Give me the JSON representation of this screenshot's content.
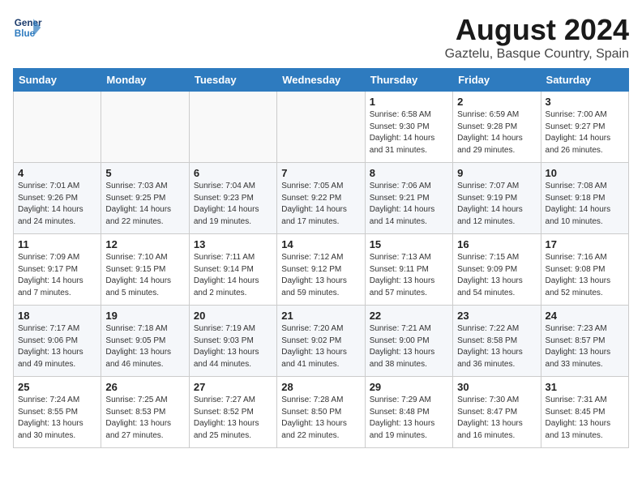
{
  "logo": {
    "line1": "General",
    "line2": "Blue"
  },
  "title": "August 2024",
  "subtitle": "Gaztelu, Basque Country, Spain",
  "days_of_week": [
    "Sunday",
    "Monday",
    "Tuesday",
    "Wednesday",
    "Thursday",
    "Friday",
    "Saturday"
  ],
  "weeks": [
    [
      {
        "num": "",
        "info": ""
      },
      {
        "num": "",
        "info": ""
      },
      {
        "num": "",
        "info": ""
      },
      {
        "num": "",
        "info": ""
      },
      {
        "num": "1",
        "info": "Sunrise: 6:58 AM\nSunset: 9:30 PM\nDaylight: 14 hours\nand 31 minutes."
      },
      {
        "num": "2",
        "info": "Sunrise: 6:59 AM\nSunset: 9:28 PM\nDaylight: 14 hours\nand 29 minutes."
      },
      {
        "num": "3",
        "info": "Sunrise: 7:00 AM\nSunset: 9:27 PM\nDaylight: 14 hours\nand 26 minutes."
      }
    ],
    [
      {
        "num": "4",
        "info": "Sunrise: 7:01 AM\nSunset: 9:26 PM\nDaylight: 14 hours\nand 24 minutes."
      },
      {
        "num": "5",
        "info": "Sunrise: 7:03 AM\nSunset: 9:25 PM\nDaylight: 14 hours\nand 22 minutes."
      },
      {
        "num": "6",
        "info": "Sunrise: 7:04 AM\nSunset: 9:23 PM\nDaylight: 14 hours\nand 19 minutes."
      },
      {
        "num": "7",
        "info": "Sunrise: 7:05 AM\nSunset: 9:22 PM\nDaylight: 14 hours\nand 17 minutes."
      },
      {
        "num": "8",
        "info": "Sunrise: 7:06 AM\nSunset: 9:21 PM\nDaylight: 14 hours\nand 14 minutes."
      },
      {
        "num": "9",
        "info": "Sunrise: 7:07 AM\nSunset: 9:19 PM\nDaylight: 14 hours\nand 12 minutes."
      },
      {
        "num": "10",
        "info": "Sunrise: 7:08 AM\nSunset: 9:18 PM\nDaylight: 14 hours\nand 10 minutes."
      }
    ],
    [
      {
        "num": "11",
        "info": "Sunrise: 7:09 AM\nSunset: 9:17 PM\nDaylight: 14 hours\nand 7 minutes."
      },
      {
        "num": "12",
        "info": "Sunrise: 7:10 AM\nSunset: 9:15 PM\nDaylight: 14 hours\nand 5 minutes."
      },
      {
        "num": "13",
        "info": "Sunrise: 7:11 AM\nSunset: 9:14 PM\nDaylight: 14 hours\nand 2 minutes."
      },
      {
        "num": "14",
        "info": "Sunrise: 7:12 AM\nSunset: 9:12 PM\nDaylight: 13 hours\nand 59 minutes."
      },
      {
        "num": "15",
        "info": "Sunrise: 7:13 AM\nSunset: 9:11 PM\nDaylight: 13 hours\nand 57 minutes."
      },
      {
        "num": "16",
        "info": "Sunrise: 7:15 AM\nSunset: 9:09 PM\nDaylight: 13 hours\nand 54 minutes."
      },
      {
        "num": "17",
        "info": "Sunrise: 7:16 AM\nSunset: 9:08 PM\nDaylight: 13 hours\nand 52 minutes."
      }
    ],
    [
      {
        "num": "18",
        "info": "Sunrise: 7:17 AM\nSunset: 9:06 PM\nDaylight: 13 hours\nand 49 minutes."
      },
      {
        "num": "19",
        "info": "Sunrise: 7:18 AM\nSunset: 9:05 PM\nDaylight: 13 hours\nand 46 minutes."
      },
      {
        "num": "20",
        "info": "Sunrise: 7:19 AM\nSunset: 9:03 PM\nDaylight: 13 hours\nand 44 minutes."
      },
      {
        "num": "21",
        "info": "Sunrise: 7:20 AM\nSunset: 9:02 PM\nDaylight: 13 hours\nand 41 minutes."
      },
      {
        "num": "22",
        "info": "Sunrise: 7:21 AM\nSunset: 9:00 PM\nDaylight: 13 hours\nand 38 minutes."
      },
      {
        "num": "23",
        "info": "Sunrise: 7:22 AM\nSunset: 8:58 PM\nDaylight: 13 hours\nand 36 minutes."
      },
      {
        "num": "24",
        "info": "Sunrise: 7:23 AM\nSunset: 8:57 PM\nDaylight: 13 hours\nand 33 minutes."
      }
    ],
    [
      {
        "num": "25",
        "info": "Sunrise: 7:24 AM\nSunset: 8:55 PM\nDaylight: 13 hours\nand 30 minutes."
      },
      {
        "num": "26",
        "info": "Sunrise: 7:25 AM\nSunset: 8:53 PM\nDaylight: 13 hours\nand 27 minutes."
      },
      {
        "num": "27",
        "info": "Sunrise: 7:27 AM\nSunset: 8:52 PM\nDaylight: 13 hours\nand 25 minutes."
      },
      {
        "num": "28",
        "info": "Sunrise: 7:28 AM\nSunset: 8:50 PM\nDaylight: 13 hours\nand 22 minutes."
      },
      {
        "num": "29",
        "info": "Sunrise: 7:29 AM\nSunset: 8:48 PM\nDaylight: 13 hours\nand 19 minutes."
      },
      {
        "num": "30",
        "info": "Sunrise: 7:30 AM\nSunset: 8:47 PM\nDaylight: 13 hours\nand 16 minutes."
      },
      {
        "num": "31",
        "info": "Sunrise: 7:31 AM\nSunset: 8:45 PM\nDaylight: 13 hours\nand 13 minutes."
      }
    ]
  ]
}
